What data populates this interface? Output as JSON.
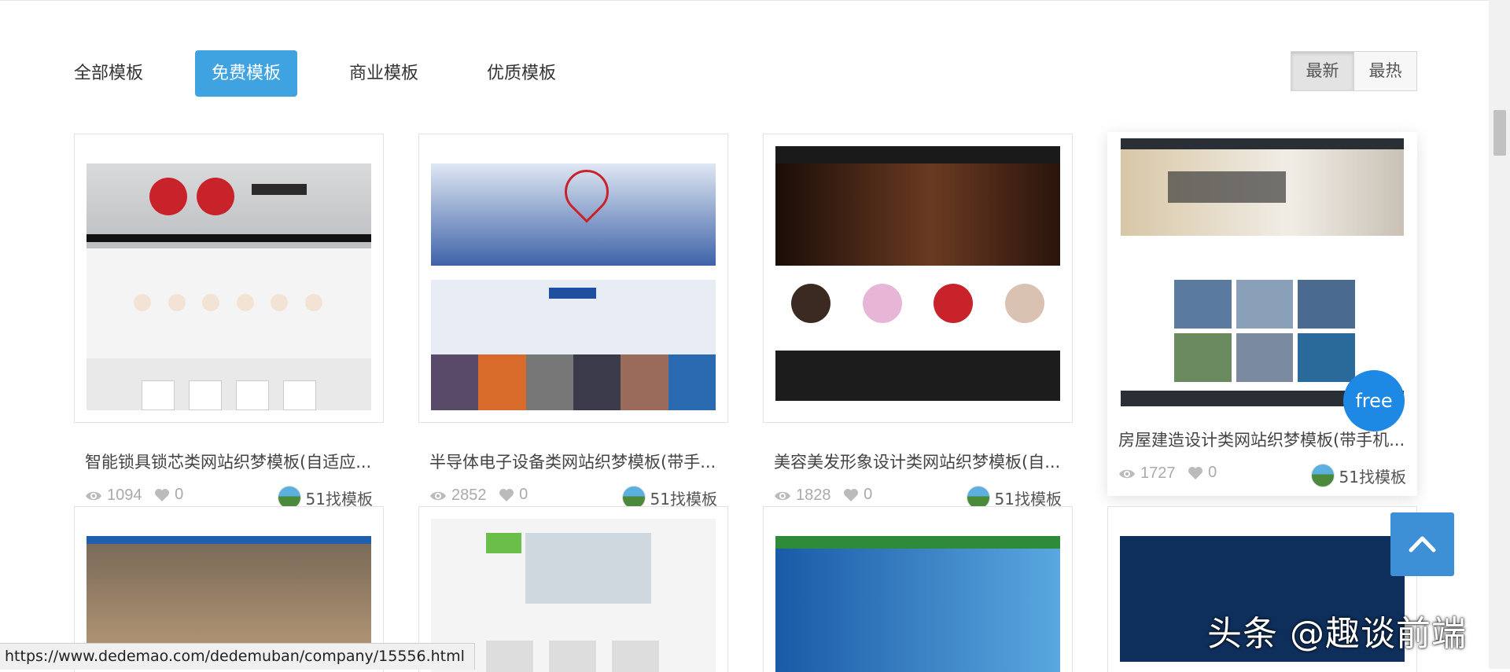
{
  "tabs": [
    {
      "label": "全部模板",
      "active": false
    },
    {
      "label": "免费模板",
      "active": true
    },
    {
      "label": "商业模板",
      "active": false
    },
    {
      "label": "优质模板",
      "active": false
    }
  ],
  "sort": [
    {
      "label": "最新",
      "active": true
    },
    {
      "label": "最热",
      "active": false
    }
  ],
  "cards": [
    {
      "title": "智能锁具锁芯类网站织梦模板(自适应...",
      "views": "1094",
      "likes": "0",
      "author": "51找模板"
    },
    {
      "title": "半导体电子设备类网站织梦模板(带手...",
      "views": "2852",
      "likes": "0",
      "author": "51找模板"
    },
    {
      "title": "美容美发形象设计类网站织梦模板(自...",
      "views": "1828",
      "likes": "0",
      "author": "51找模板"
    },
    {
      "title": "房屋建造设计类网站织梦模板(带手机...",
      "views": "1727",
      "likes": "0",
      "author": "51找模板",
      "badge": "free"
    }
  ],
  "status_url": "https://www.dedemao.com/dedemuban/company/15556.html",
  "watermark": "头条 @趣谈前端",
  "colors": {
    "accent": "#3ea3e0",
    "badge": "#1e88e5",
    "backtop": "#3d8fd6"
  },
  "icons": {
    "views": "eye-icon",
    "likes": "heart-icon",
    "backtop": "chevron-up-icon"
  }
}
